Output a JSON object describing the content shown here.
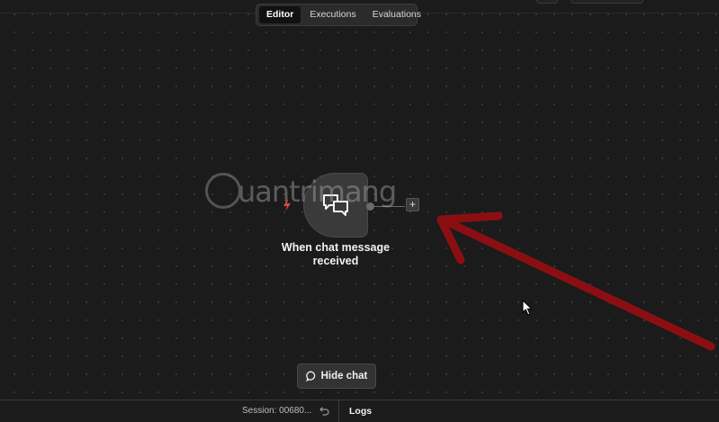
{
  "tabs": [
    {
      "label": "Editor",
      "active": true
    },
    {
      "label": "Executions",
      "active": false
    },
    {
      "label": "Evaluations",
      "active": false
    }
  ],
  "node": {
    "label": "When chat message received",
    "icon": "chat-bubbles-icon",
    "trigger_icon": "lightning-bolt-icon"
  },
  "add_node": {
    "symbol": "+"
  },
  "watermark": {
    "text": "uantrimang"
  },
  "chat_toggle": {
    "label": "Hide chat",
    "icon": "chat-icon"
  },
  "footer": {
    "session": "Session: 00680...",
    "logs": "Logs"
  },
  "colors": {
    "background": "#1b1b1b",
    "node": "#3a3a3a",
    "arrow": "#8b0f12",
    "trigger": "#e0443c"
  }
}
